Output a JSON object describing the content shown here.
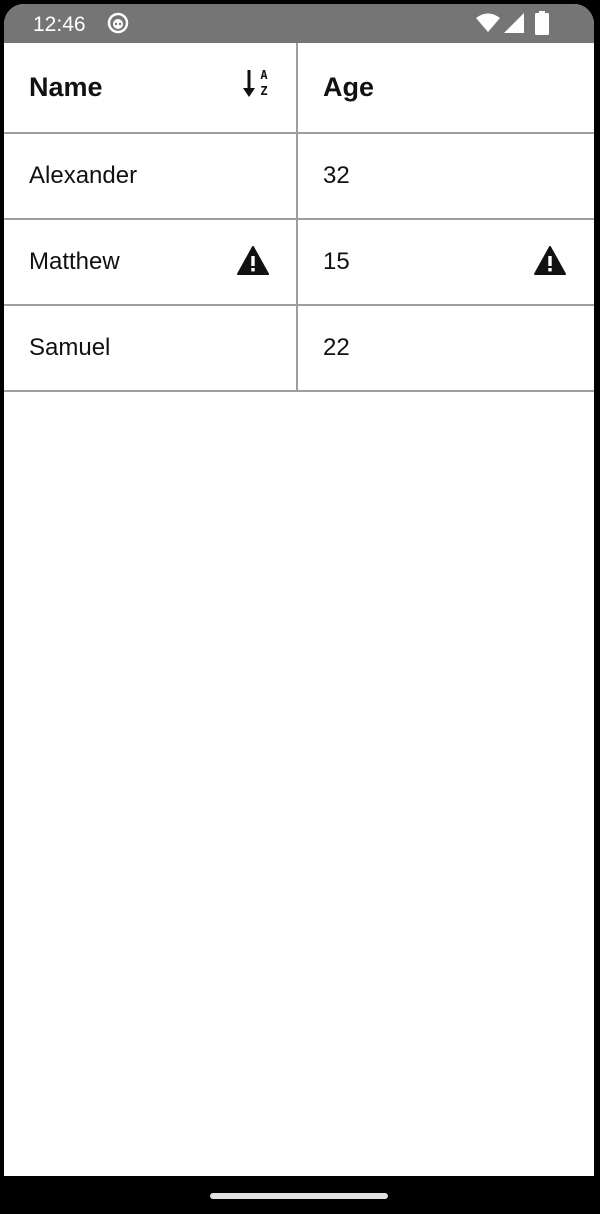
{
  "status_bar": {
    "time": "12:46",
    "icons": [
      "app-notification-icon",
      "wifi-icon",
      "signal-icon",
      "battery-icon"
    ]
  },
  "table": {
    "columns": [
      {
        "label": "Name",
        "sort_icon": "sort-alpha-ascending-icon"
      },
      {
        "label": "Age"
      }
    ],
    "rows": [
      {
        "name": "Alexander",
        "age": "32",
        "warning": false
      },
      {
        "name": "Matthew",
        "age": "15",
        "warning": true
      },
      {
        "name": "Samuel",
        "age": "22",
        "warning": false
      }
    ]
  },
  "colors": {
    "status_bar": "#757575",
    "grid_line": "#9e9e9e",
    "text": "#111111",
    "background": "#ffffff"
  }
}
